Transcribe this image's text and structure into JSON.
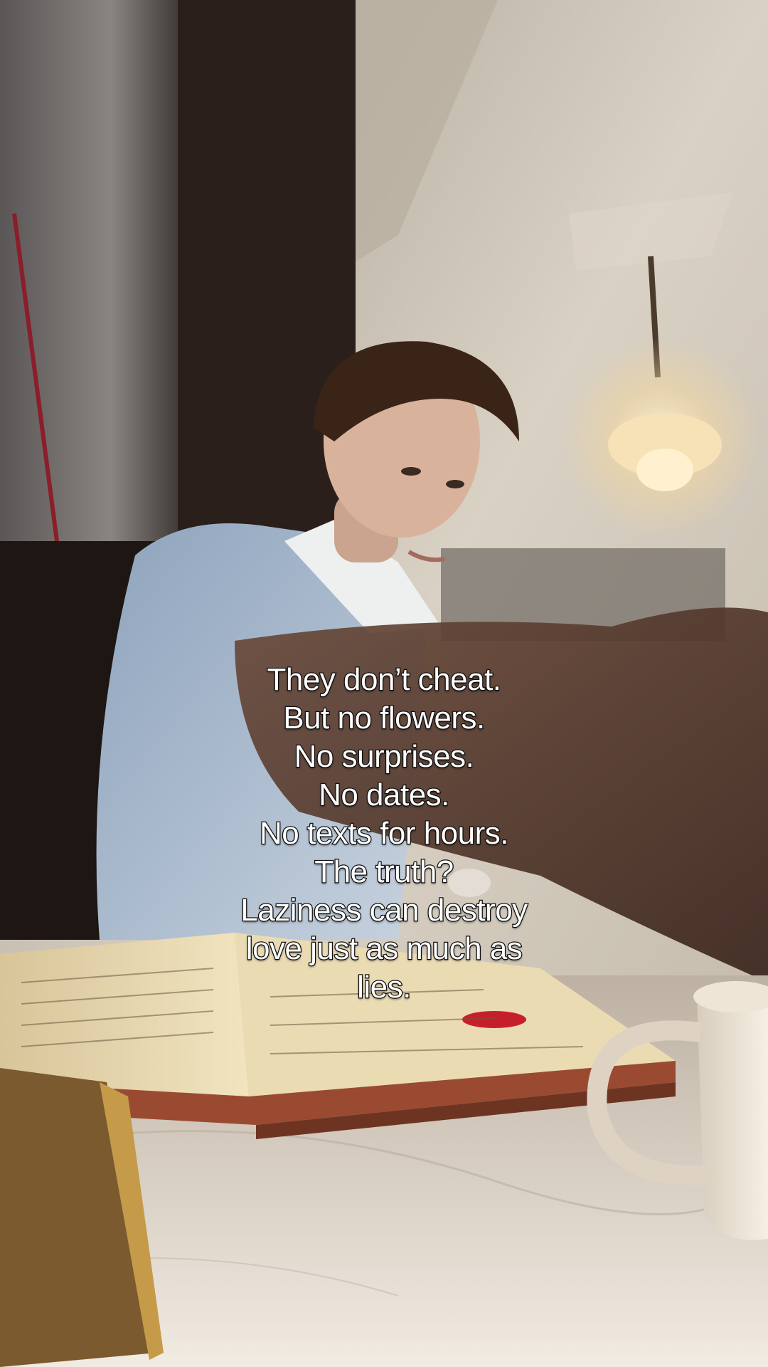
{
  "caption": {
    "lines": [
      "They don’t cheat.",
      "But no flowers.",
      "No surprises.",
      "No dates.",
      "No texts for hours.",
      "The truth?",
      "Laziness can destroy",
      "love just as much as",
      "lies."
    ]
  },
  "scene": {
    "description_icons": [
      "chandelier-icon",
      "book-icon",
      "cup-icon"
    ],
    "colors": {
      "wall": "#cfc6b8",
      "shadow": "#1c1612",
      "shirt": "#9fb3c8",
      "table": "#e8e0d6",
      "book_page": "#e6d3a8",
      "lamp_glow": "#ffe7b0"
    }
  }
}
